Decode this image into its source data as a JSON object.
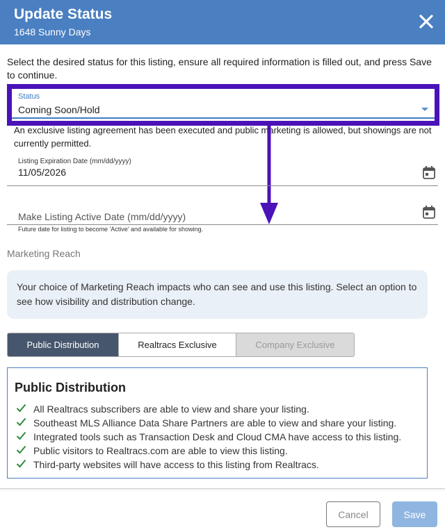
{
  "header": {
    "title": "Update Status",
    "subtitle": "1648 Sunny Days"
  },
  "intro_text": "Select the desired status for this listing, ensure all required information is filled out, and press Save to continue.",
  "status_field": {
    "label": "Status",
    "value": "Coming Soon/Hold",
    "description": "An exclusive listing agreement has been executed and public marketing is allowed, but showings are not currently permitted."
  },
  "expiration_field": {
    "label": "Listing Expiration Date (mm/dd/yyyy)",
    "value": "11/05/2026"
  },
  "active_date_field": {
    "placeholder": "Make Listing Active Date (mm/dd/yyyy)",
    "hint": "Future date for listing to become 'Active' and available for showing."
  },
  "marketing": {
    "section_label": "Marketing Reach",
    "info": "Your choice of Marketing Reach impacts who can see and use this listing. Select an option to see how visibility and distribution change.",
    "options": [
      "Public Distribution",
      "Realtracs Exclusive",
      "Company Exclusive"
    ],
    "selected": "Public Distribution"
  },
  "distribution_panel": {
    "title": "Public Distribution",
    "items": [
      "All Realtracs subscribers are able to view and share your listing.",
      "Southeast MLS Alliance Data Share Partners are able to view and share your listing.",
      "Integrated tools such as Transaction Desk and Cloud CMA have access to this listing.",
      "Public visitors to Realtracs.com are able to view this listing.",
      "Third-party websites will have access to this listing from Realtracs."
    ]
  },
  "footer": {
    "cancel_label": "Cancel",
    "save_label": "Save"
  },
  "colors": {
    "header_bg": "#4a7fc1",
    "highlight": "#4a12b8",
    "selected_segment": "#46566d",
    "check": "#2e8b3a"
  },
  "icons": {
    "close": "close-icon",
    "calendar": "calendar-icon",
    "dropdown": "chevron-down-icon",
    "check": "check-icon"
  }
}
